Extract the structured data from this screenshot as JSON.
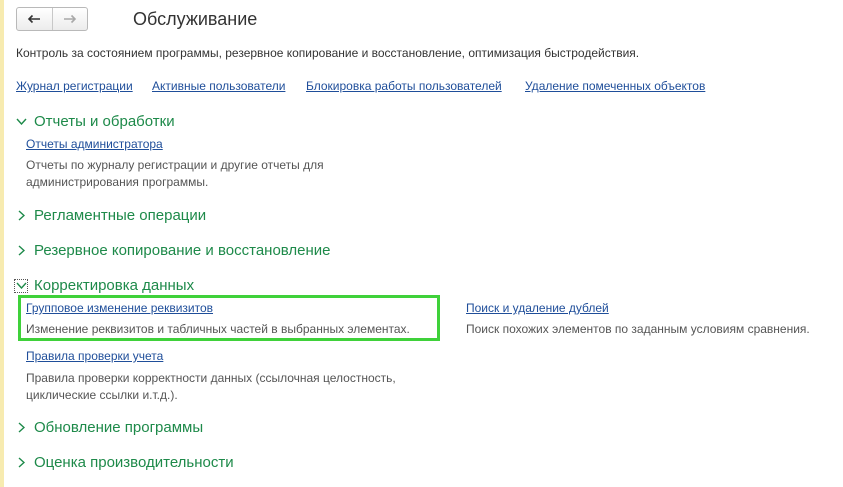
{
  "nav": {
    "back_symbol": "🡐",
    "forward_symbol": "🡒"
  },
  "page_title": "Обслуживание",
  "description": "Контроль за состоянием программы, резервное копирование и восстановление, оптимизация быстродействия.",
  "top_links": [
    "Журнал регистрации",
    "Активные пользователи",
    "Блокировка работы пользователей",
    "Удаление помеченных объектов"
  ],
  "sections": {
    "reports": {
      "title": "Отчеты и обработки",
      "items": [
        {
          "link": "Отчеты администратора",
          "desc_line1": "Отчеты по журналу регистрации и другие отчеты для",
          "desc_line2": "администрирования программы."
        }
      ]
    },
    "routine": {
      "title": "Регламентные операции"
    },
    "backup": {
      "title": "Резервное копирование и восстановление"
    },
    "data_correction": {
      "title": "Корректировка данных",
      "items": [
        {
          "link": "Групповое изменение реквизитов",
          "desc": "Изменение реквизитов и табличных частей в выбранных элементах."
        },
        {
          "link": "Поиск и удаление дублей",
          "desc": "Поиск похожих элементов по заданным условиям сравнения."
        },
        {
          "link": "Правила проверки учета",
          "desc_line1": "Правила проверки корректности данных (ссылочная целостность,",
          "desc_line2": "циклические ссылки и.т.д.)."
        }
      ]
    },
    "update": {
      "title": "Обновление программы"
    },
    "performance": {
      "title": "Оценка производительности"
    }
  },
  "colors": {
    "section_green": "#1e8a4a",
    "link_blue": "#1f4e9a",
    "highlight_green": "#3fd13a",
    "strip_yellow": "#f7ebb0"
  }
}
